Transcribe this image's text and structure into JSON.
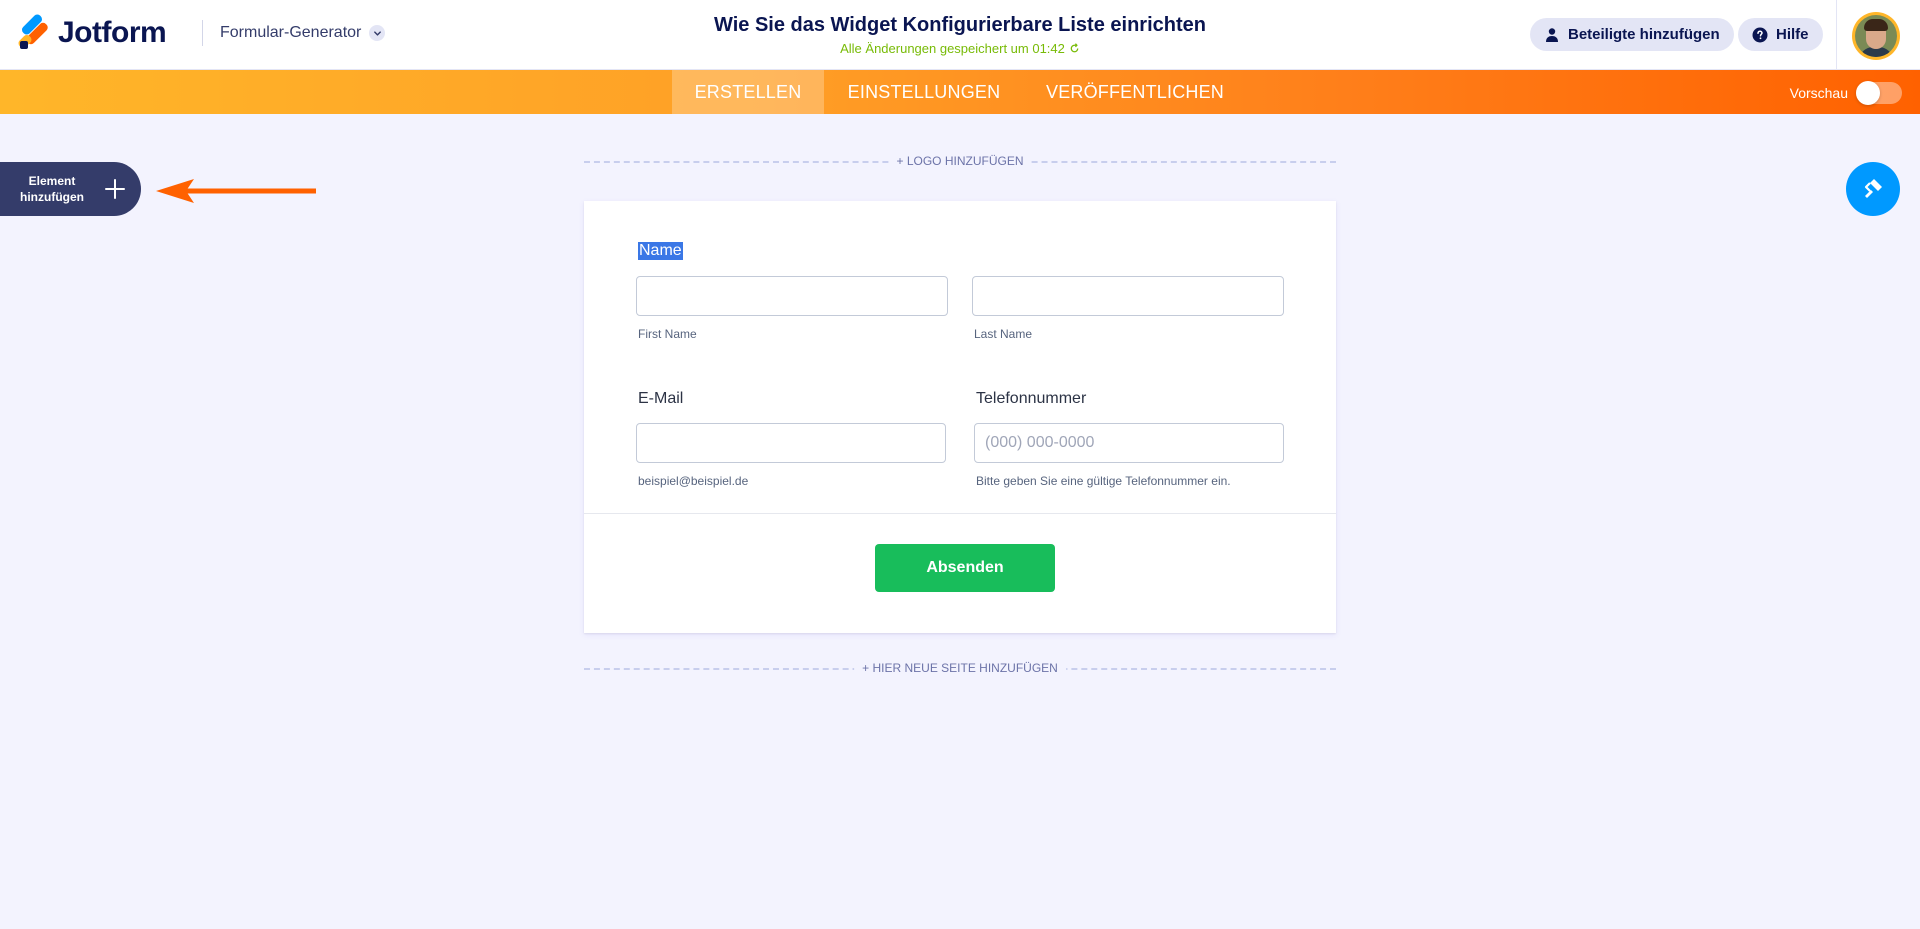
{
  "header": {
    "logo_text": "Jotform",
    "builder_menu_label": "Formular-Generator",
    "form_title": "Wie Sie das Widget Konfigurierbare Liste einrichten",
    "saved_status": "Alle Änderungen gespeichert um 01:42",
    "collaborators_label": "Beteiligte hinzufügen",
    "help_label": "Hilfe"
  },
  "nav": {
    "tabs": [
      {
        "label": "ERSTELLEN",
        "active": true
      },
      {
        "label": "EINSTELLUNGEN",
        "active": false
      },
      {
        "label": "VERÖFFENTLICHEN",
        "active": false
      }
    ],
    "preview_label": "Vorschau",
    "preview_on": false
  },
  "sidebar": {
    "add_element_line1": "Element",
    "add_element_line2": "hinzufügen"
  },
  "canvas": {
    "add_logo_label": "+ LOGO HINZUFÜGEN",
    "add_page_label": "+ HIER NEUE SEITE HINZUFÜGEN"
  },
  "form": {
    "name_label": "Name",
    "first_name_value": "",
    "first_name_sublabel": "First Name",
    "last_name_value": "",
    "last_name_sublabel": "Last Name",
    "email_label": "E-Mail",
    "email_value": "",
    "email_sublabel": "beispiel@beispiel.de",
    "phone_label": "Telefonnummer",
    "phone_placeholder": "(000) 000-0000",
    "phone_sublabel": "Bitte geben Sie eine gültige Telefonnummer ein.",
    "submit_label": "Absenden"
  },
  "colors": {
    "brand_navy": "#0a1551",
    "accent_orange": "#ff6100",
    "accent_yellow": "#ffb629",
    "design_blue": "#0099ff",
    "submit_green": "#18bd5b",
    "saved_green": "#78bb07"
  },
  "icons": {
    "builder_menu": "chevron-down-icon",
    "saved_status": "refresh-icon",
    "collaborators": "user-icon",
    "help": "question-circle-icon",
    "add_element": "plus-icon",
    "design": "paint-roller-icon"
  }
}
